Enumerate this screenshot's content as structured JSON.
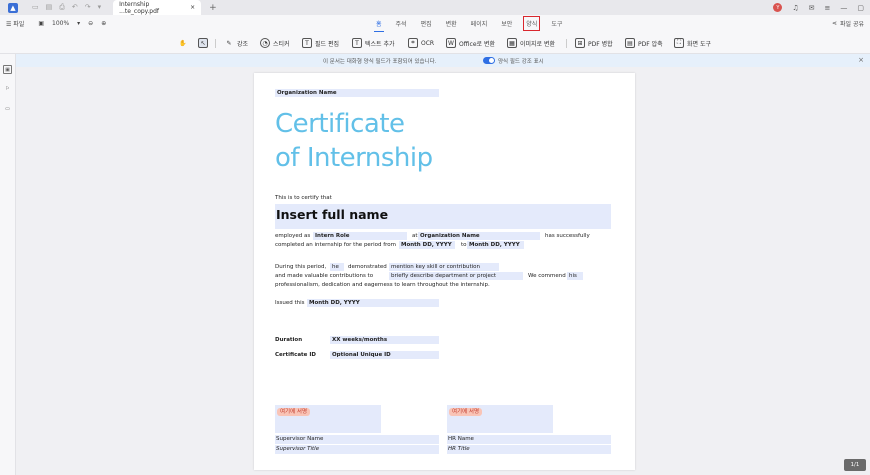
{
  "tab": {
    "title": "Internship ...te_copy.pdf",
    "close": "×",
    "add": "+"
  },
  "titlebar": {
    "avatar": "Y"
  },
  "menu": {
    "file": "☰ 파일",
    "zoom": "100%",
    "tabs": [
      "홈",
      "주석",
      "편집",
      "변환",
      "페이지",
      "보안",
      "양식",
      "도구"
    ],
    "share": "파일 공유"
  },
  "toolbar": {
    "highlight": "강조",
    "sticker": "스티커",
    "field_edit": "필드 편집",
    "text_add": "텍스트 추가",
    "ocr": "OCR",
    "to_office": "Office로 변환",
    "to_image": "이미지로 변환",
    "pdf_merge": "PDF 병합",
    "pdf_compress": "PDF 압축",
    "screen_tool": "화면 도구"
  },
  "notice": {
    "text": "이 문서는 대화형 양식 필드가 포함되어 있습니다.",
    "toggle_label": "양식 필드 강조 표시"
  },
  "document": {
    "org_name": "Organization Name",
    "title_line1": "Certificate",
    "title_line2": "of Internship",
    "certify": "This is to certify that",
    "full_name": "Insert full name",
    "employed_as": "employed as",
    "intern_role": "Intern Role",
    "at": "at",
    "org_name_field": "Organization Name",
    "has_completed": "has successfully",
    "completed_internship": "completed an internship for the period from",
    "date_from": "Month DD, YYYY",
    "to": "to",
    "date_to": "Month DD, YYYY",
    "during": "During this period,",
    "pronoun": "he",
    "demonstrated": "demonstrated",
    "skill": "mention key skill or contribution",
    "contributions": "and made valuable contributions to",
    "department": "briefly describe department or project",
    "commend": "We commend",
    "his": "his",
    "professionalism": "professionalism, dedication and eagerness to learn throughout the internship.",
    "issued": "Issued this",
    "issued_date": "Month DD, YYYY",
    "duration_label": "Duration",
    "duration_value": "XX weeks/months",
    "cert_id_label": "Certificate ID",
    "cert_id_value": "Optional Unique ID",
    "sign_tag": "여기에 서명",
    "sup_name": "Supervisor Name",
    "sup_title": "Supervisor Title",
    "hr_name": "HR Name",
    "hr_title": "HR Title"
  },
  "pager": "1/1"
}
